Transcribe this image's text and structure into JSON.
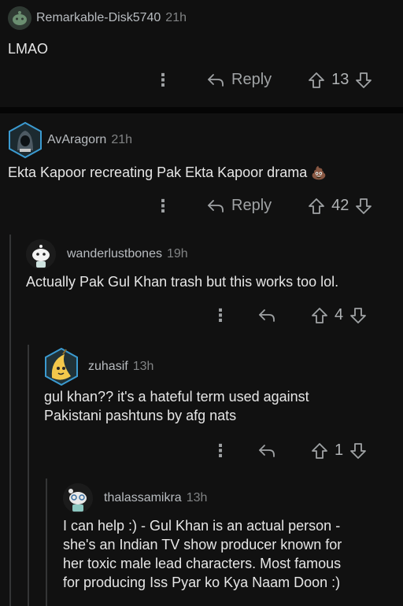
{
  "comments": [
    {
      "username": "Remarkable-Disk5740",
      "age": "21h",
      "body": "LMAO",
      "reply_label": "Reply",
      "score": "13"
    },
    {
      "username": "AvAragorn",
      "age": "21h",
      "body": "Ekta Kapoor recreating Pak Ekta Kapoor drama",
      "emoji": "💩",
      "reply_label": "Reply",
      "score": "42"
    },
    {
      "username": "wanderlustbones",
      "age": "19h",
      "body": "Actually Pak Gul Khan trash but this works too lol.",
      "score": "4"
    },
    {
      "username": "zuhasif",
      "age": "13h",
      "body_line1": "gul khan?? it's a hateful term used against",
      "body_line2": "Pakistani pashtuns by afg nats",
      "score": "1"
    },
    {
      "username": "thalassamikra",
      "age": "13h",
      "body_line1": "I can help :) - Gul Khan is an actual person -",
      "body_line2": "she's an Indian TV show producer known for",
      "body_line3": "her toxic male lead characters. Most famous",
      "body_line4": "for producing Iss Pyar ko Kya Naam Doon :)"
    }
  ],
  "icons": {
    "more": "more-options-icon",
    "reply": "reply-arrow-icon",
    "upvote": "upvote-arrow-icon",
    "downvote": "downvote-arrow-icon"
  },
  "colors": {
    "background": "#111111",
    "text": "#e6e6e6",
    "meta": "#818384",
    "thread_line": "#343536"
  }
}
